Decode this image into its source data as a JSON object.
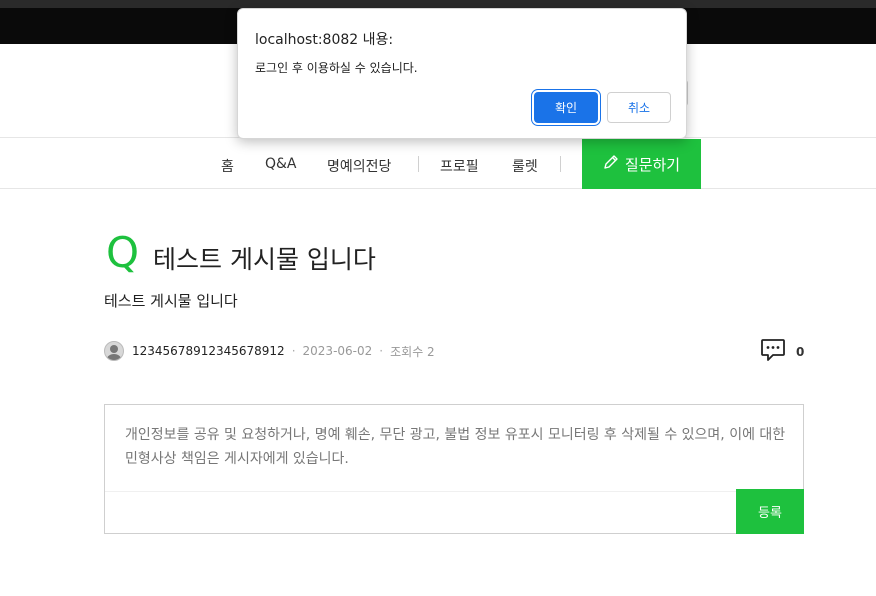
{
  "nav": {
    "items": [
      "홈",
      "Q&A",
      "명예의전당",
      "프로필",
      "룰렛"
    ],
    "ask_label": "질문하기"
  },
  "post": {
    "q_mark": "Q",
    "title": "테스트 게시물 입니다",
    "body": "테스트 게시물 입니다",
    "author": "12345678912345678912",
    "date": "2023-06-02",
    "views": "조회수 2",
    "comment_count": "0"
  },
  "comment": {
    "placeholder": "개인정보를 공유 및 요청하거나, 명예 훼손, 무단 광고, 불법 정보 유포시 모니터링 후 삭제될 수 있으며, 이에 대한 민형사상 책임은 게시자에게 있습니다.",
    "submit_label": "등록"
  },
  "dialog": {
    "title": "localhost:8082 내용:",
    "message": "로그인 후 이용하실 수 있습니다.",
    "ok_label": "확인",
    "cancel_label": "취소"
  },
  "colors": {
    "accent": "#1ec13e",
    "dialog_button": "#1a73e8"
  },
  "icons": {
    "ask": "pencil-icon",
    "comment": "chat-bubble-icon",
    "avatar": "user-avatar-icon"
  }
}
